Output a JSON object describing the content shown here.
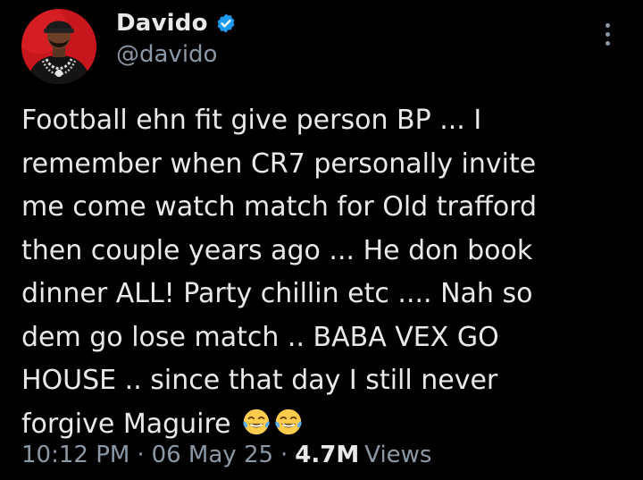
{
  "author": {
    "display_name": "Davido",
    "handle": "@davido",
    "verified": true,
    "verified_color": "#1d9bf0",
    "avatar_icon": "profile-photo"
  },
  "menu_icon": "more-vertical-icon",
  "tweet": {
    "lines": [
      "Football ehn fit give person BP ... I",
      "remember when CR7 personally invite",
      "me come watch match for Old trafford",
      "then couple years ago ... He don book",
      "dinner ALL! Party chillin etc .... Nah so",
      "dem go lose match .. BABA VEX GO",
      "HOUSE .. since that day I still never",
      "forgive Maguire"
    ],
    "emojis": [
      "face-with-tears-of-joy",
      "face-with-tears-of-joy"
    ]
  },
  "meta": {
    "time": "10:12 PM",
    "separator": "·",
    "date": "06 May 25",
    "views_count": "4.7M",
    "views_label": "Views"
  },
  "colors": {
    "background": "#000000",
    "text_primary": "#e7e9ea",
    "text_secondary": "#8b98a5",
    "avatar_bg": "#c8161d"
  }
}
